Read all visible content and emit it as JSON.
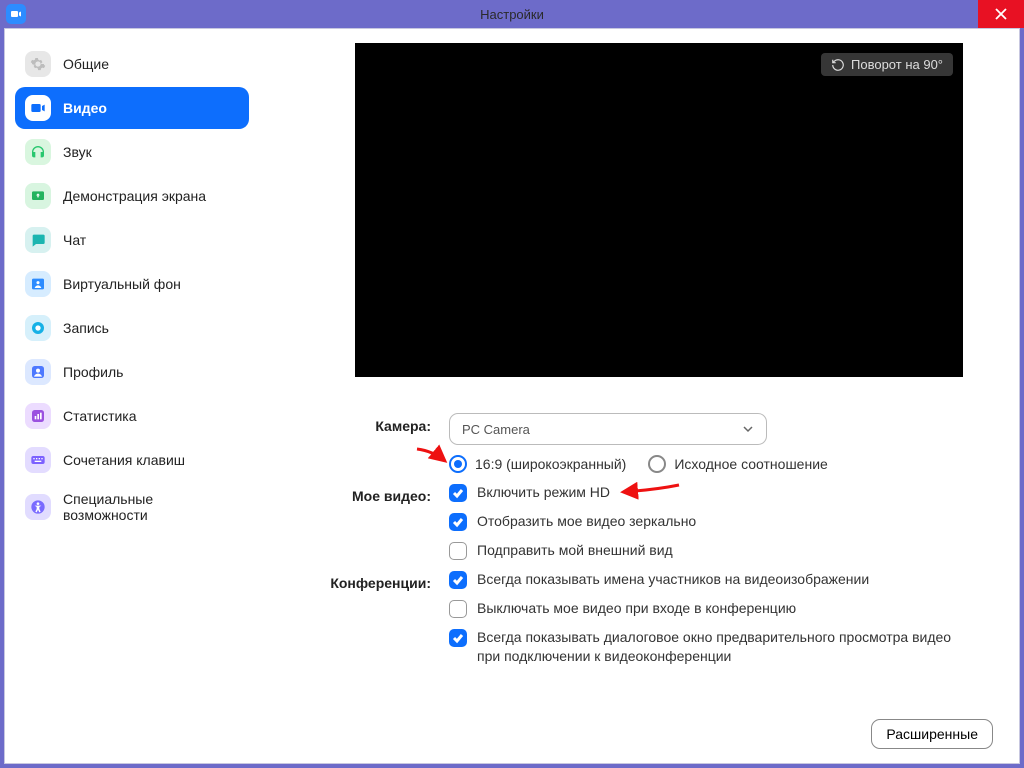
{
  "title": "Настройки",
  "sidebar": {
    "items": [
      {
        "label": "Общие",
        "icon": "gear",
        "bg": "#e7e7e7",
        "fg": "#bdbdbd"
      },
      {
        "label": "Видео",
        "icon": "video",
        "bg": "#ffffff",
        "fg": "#0d6efd",
        "active": true
      },
      {
        "label": "Звук",
        "icon": "headphones",
        "bg": "#d9f6df",
        "fg": "#28c76f"
      },
      {
        "label": "Демонстрация экрана",
        "icon": "share",
        "bg": "#d8f5e0",
        "fg": "#24b35f"
      },
      {
        "label": "Чат",
        "icon": "chat",
        "bg": "#d7f1f0",
        "fg": "#1cb5b0"
      },
      {
        "label": "Виртуальный фон",
        "icon": "vbg",
        "bg": "#d6ecff",
        "fg": "#2d8cff"
      },
      {
        "label": "Запись",
        "icon": "record",
        "bg": "#d6f0fb",
        "fg": "#16b1e6"
      },
      {
        "label": "Профиль",
        "icon": "profile",
        "bg": "#dce8ff",
        "fg": "#4d79ff"
      },
      {
        "label": "Статистика",
        "icon": "stats",
        "bg": "#ecdcff",
        "fg": "#9b51e0"
      },
      {
        "label": "Сочетания клавиш",
        "icon": "keyboard",
        "bg": "#e3dcff",
        "fg": "#7b61ff"
      },
      {
        "label": "Специальные возможности",
        "icon": "access",
        "bg": "#e1dcff",
        "fg": "#7a6bff"
      }
    ]
  },
  "preview": {
    "rotate_label": "Поворот на 90°"
  },
  "form": {
    "camera_label": "Камера:",
    "camera_value": "PC Camera",
    "ratio_wide": "16:9 (широкоэкранный)",
    "ratio_orig": "Исходное соотношение",
    "myvideo_label": "Мое видео:",
    "hd": "Включить режим HD",
    "mirror": "Отобразить мое видео зеркально",
    "touchup": "Подправить мой внешний вид",
    "meetings_label": "Конференции:",
    "meet1": "Всегда показывать имена участников на видеоизображении",
    "meet2": "Выключать мое видео при входе в конференцию",
    "meet3": "Всегда показывать диалоговое окно предварительного просмотра видео при подключении к видеоконференции",
    "advanced": "Расширенные"
  }
}
